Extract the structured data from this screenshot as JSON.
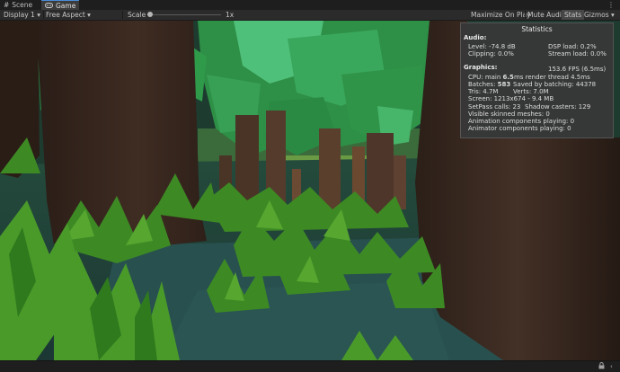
{
  "tabs": [
    {
      "label": "Scene",
      "icon": "hash-grid-icon"
    },
    {
      "label": "Game",
      "icon": "gamepad-icon"
    }
  ],
  "menu_icon": "kebab-menu-icon",
  "toolbar": {
    "display": "Display 1",
    "aspect": "Free Aspect",
    "scale_label": "Scale",
    "scale_value": "1x",
    "buttons": [
      "Maximize On Play",
      "Mute Audio",
      "Stats",
      "Gizmos"
    ]
  },
  "stats": {
    "title": "Statistics",
    "audio_header": "Audio:",
    "level": "Level: -74.8 dB",
    "clipping": "Clipping: 0.0%",
    "dsp_load": "DSP load: 0.2%",
    "stream_load": "Stream load: 0.0%",
    "graphics_header": "Graphics:",
    "fps": "153.6 FPS (6.5ms)",
    "cpu_prefix": "CPU: main ",
    "cpu_main": "6.5",
    "cpu_suffix": "ms  render thread 4.5ms",
    "batches_prefix": "Batches: ",
    "batches": "583",
    "saved_batching": "Saved by batching: 44378",
    "tris": "Tris: 4.7M",
    "verts": "Verts: 7.0M",
    "screen": "Screen: 1213x674 - 9.4 MB",
    "setpass": "SetPass calls: 23",
    "shadow_casters": "Shadow casters: 129",
    "skinned": "Visible skinned meshes: 0",
    "anim_components": "Animation components playing: 0",
    "animator_components": "Animator components playing: 0"
  },
  "status_icons": [
    "lock-icon",
    "chevron-icon"
  ],
  "colors": {
    "panel_bg": "#2b2b2b",
    "accent": "#4a8cd8",
    "trunk": "#3b2a20",
    "canopy": "#2f9a4a",
    "grass": "#3f8a26",
    "water": "#27484a"
  }
}
